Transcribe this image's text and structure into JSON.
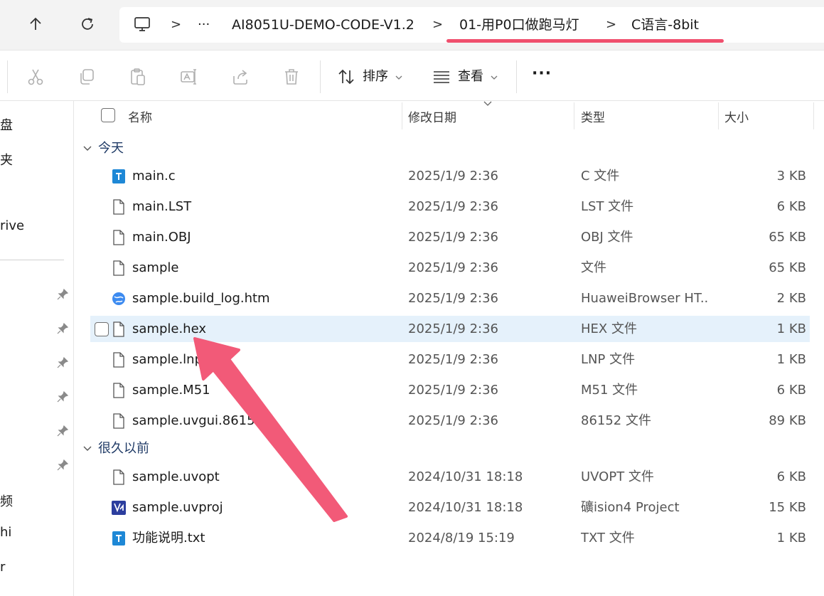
{
  "address_bar": {
    "crumbs": [
      "AI8051U-DEMO-CODE-V1.2",
      "01-用P0口做跑马灯",
      "C语言-8bit"
    ],
    "ellipsis": "···",
    "separator": ">"
  },
  "command_bar": {
    "sort_label": "排序",
    "view_label": "查看",
    "more_label": "···"
  },
  "nav_pane": {
    "items": [
      "盘",
      "夹",
      "rive",
      "频",
      "hi",
      "r"
    ]
  },
  "columns": {
    "name": "名称",
    "date": "修改日期",
    "type": "类型",
    "size": "大小"
  },
  "groups": [
    {
      "label": "今天",
      "files": [
        {
          "name": "main.c",
          "date": "2025/1/9 2:36",
          "type": "C 文件",
          "size": "3 KB",
          "icon": "text-file-icon"
        },
        {
          "name": "main.LST",
          "date": "2025/1/9 2:36",
          "type": "LST 文件",
          "size": "6 KB",
          "icon": "blank-file-icon"
        },
        {
          "name": "main.OBJ",
          "date": "2025/1/9 2:36",
          "type": "OBJ 文件",
          "size": "65 KB",
          "icon": "blank-file-icon"
        },
        {
          "name": "sample",
          "date": "2025/1/9 2:36",
          "type": "文件",
          "size": "65 KB",
          "icon": "blank-file-icon"
        },
        {
          "name": "sample.build_log.htm",
          "date": "2025/1/9 2:36",
          "type": "HuaweiBrowser HT...",
          "size": "2 KB",
          "icon": "browser-icon"
        },
        {
          "name": "sample.hex",
          "date": "2025/1/9 2:36",
          "type": "HEX 文件",
          "size": "1 KB",
          "icon": "blank-file-icon",
          "selected": true
        },
        {
          "name": "sample.lnp",
          "date": "2025/1/9 2:36",
          "type": "LNP 文件",
          "size": "1 KB",
          "icon": "blank-file-icon"
        },
        {
          "name": "sample.M51",
          "date": "2025/1/9 2:36",
          "type": "M51 文件",
          "size": "6 KB",
          "icon": "blank-file-icon"
        },
        {
          "name": "sample.uvgui.86152",
          "date": "2025/1/9 2:36",
          "type": "86152 文件",
          "size": "89 KB",
          "icon": "blank-file-icon"
        }
      ]
    },
    {
      "label": "很久以前",
      "files": [
        {
          "name": "sample.uvopt",
          "date": "2024/10/31 18:18",
          "type": "UVOPT 文件",
          "size": "6 KB",
          "icon": "blank-file-icon"
        },
        {
          "name": "sample.uvproj",
          "date": "2024/10/31 18:18",
          "type": "礦ision4 Project",
          "size": "15 KB",
          "icon": "uvision-icon"
        },
        {
          "name": "功能说明.txt",
          "date": "2024/8/19 15:19",
          "type": "TXT 文件",
          "size": "1 KB",
          "icon": "text-file-icon"
        }
      ]
    }
  ],
  "colors": {
    "accent_underline": "#f0506e",
    "arrow": "#f25a78",
    "selection": "#e5f1fb",
    "text_file_blue": "#1e88d6"
  }
}
